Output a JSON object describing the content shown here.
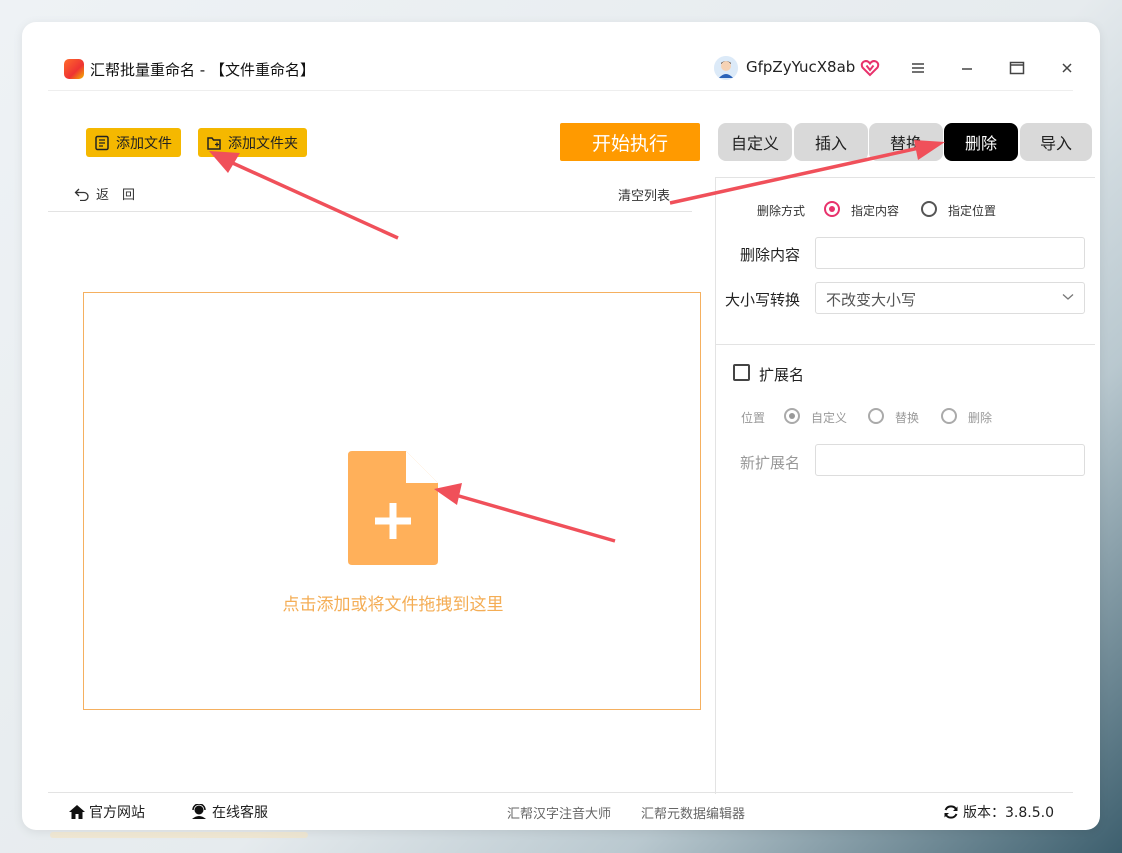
{
  "window": {
    "app_title": "汇帮批量重命名 - 【文件重命名】",
    "username": "GfpZyYucX8ab"
  },
  "toolbar": {
    "add_file": "添加文件",
    "add_folder": "添加文件夹",
    "start": "开始执行"
  },
  "tabs": [
    {
      "label": "自定义",
      "active": false
    },
    {
      "label": "插入",
      "active": false
    },
    {
      "label": "替换",
      "active": false
    },
    {
      "label": "删除",
      "active": true
    },
    {
      "label": "导入",
      "active": false
    }
  ],
  "list": {
    "back": "返　回",
    "clear": "清空列表",
    "drop_hint": "点击添加或将文件拖拽到这里"
  },
  "panel": {
    "delete_mode_label": "删除方式",
    "mode_options": [
      "指定内容",
      "指定位置"
    ],
    "mode_selected": "指定内容",
    "delete_content_label": "删除内容",
    "delete_content_value": "",
    "case_label": "大小写转换",
    "case_value": "不改变大小写",
    "ext_label": "扩展名",
    "ext_checked": false,
    "position_label": "位置",
    "position_options": [
      "自定义",
      "替换",
      "删除"
    ],
    "position_selected": "自定义",
    "new_ext_label": "新扩展名",
    "new_ext_value": ""
  },
  "footer": {
    "website": "官方网站",
    "support": "在线客服",
    "link1": "汇帮汉字注音大师",
    "link2": "汇帮元数据编辑器",
    "version": "版本：3.8.5.0"
  },
  "colors": {
    "yellow_button": "#f5b800",
    "start_button": "#ff9a00",
    "active_tab": "#000000",
    "radio_accent": "#e8326c",
    "drop_accent": "#f4ad55",
    "annotation_arrow": "#f0505a"
  }
}
